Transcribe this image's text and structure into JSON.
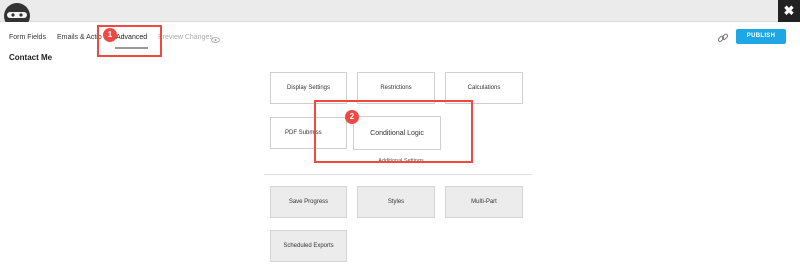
{
  "window": {
    "close_symbol": "✖"
  },
  "logo": {
    "icon": "ninja-icon"
  },
  "nav": {
    "tabs": [
      {
        "label": "Form Fields"
      },
      {
        "label": "Emails & Actio"
      },
      {
        "label": "Advanced"
      },
      {
        "label": "Preview Changes"
      }
    ]
  },
  "toolbar": {
    "publish_label": "PUBLISH",
    "link_icon": "link-icon"
  },
  "page": {
    "title": "Contact Me"
  },
  "settings": {
    "row1": [
      "Display Settings",
      "Restrictions",
      "Calculations"
    ],
    "row2_left": "PDF Submiss",
    "row2_center": "Conditional Logic",
    "additional_label": "Additional Settings",
    "row3": [
      "Save Progress",
      "Styles",
      "Multi-Part"
    ],
    "row4": [
      "Scheduled Exports"
    ]
  },
  "annotations": {
    "badge1": "1",
    "badge2": "2",
    "color": "#ef4a41"
  },
  "colors": {
    "accent": "#1ea7e4"
  }
}
